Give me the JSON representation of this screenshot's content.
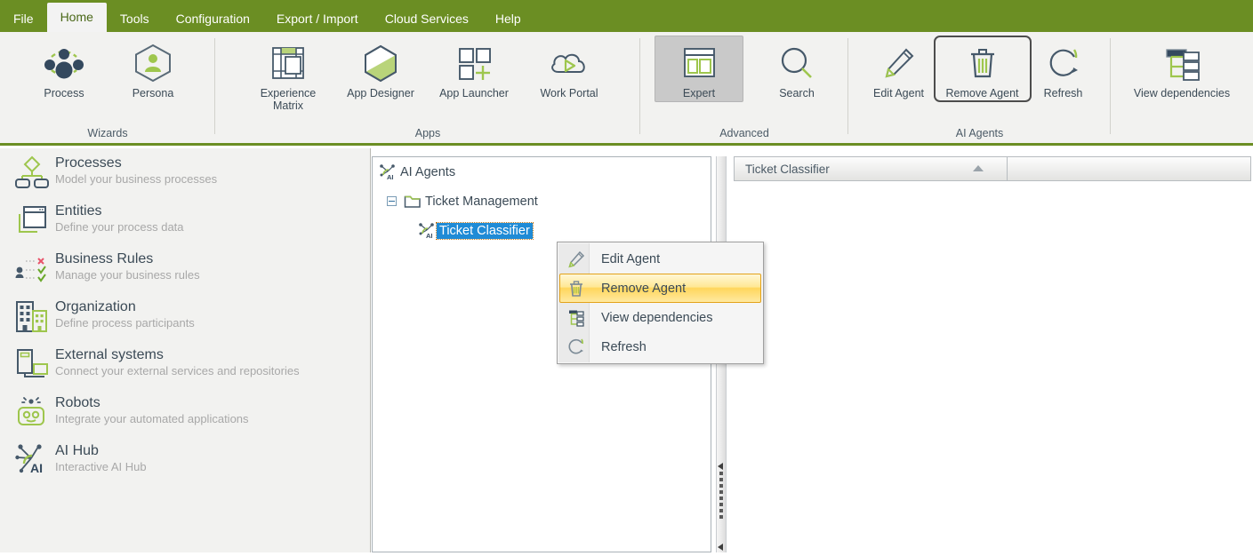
{
  "menubar": {
    "tabs": [
      {
        "label": "File",
        "active": false
      },
      {
        "label": "Home",
        "active": true
      },
      {
        "label": "Tools",
        "active": false
      },
      {
        "label": "Configuration",
        "active": false
      },
      {
        "label": "Export / Import",
        "active": false
      },
      {
        "label": "Cloud Services",
        "active": false
      },
      {
        "label": "Help",
        "active": false
      }
    ]
  },
  "ribbon": {
    "groups": [
      {
        "name": "Wizards",
        "label": "Wizards",
        "buttons": [
          {
            "label": "Process",
            "icon": "process-network-icon"
          },
          {
            "label": "Persona",
            "icon": "persona-hexagon-icon"
          }
        ]
      },
      {
        "name": "Apps",
        "label": "Apps",
        "buttons": [
          {
            "label": "Experience\nMatrix",
            "icon": "experience-matrix-icon"
          },
          {
            "label": "App Designer",
            "icon": "app-designer-hexagon-icon"
          },
          {
            "label": "App Launcher",
            "icon": "app-launcher-icon"
          },
          {
            "label": "Work Portal",
            "icon": "work-portal-cloud-icon"
          }
        ]
      },
      {
        "name": "Advanced",
        "label": "Advanced",
        "buttons": [
          {
            "label": "Expert",
            "icon": "expert-layout-icon",
            "state": "pressed"
          },
          {
            "label": "Search",
            "icon": "search-magnifier-icon"
          }
        ]
      },
      {
        "name": "AI Agents",
        "label": "AI Agents",
        "buttons": [
          {
            "label": "Edit Agent",
            "icon": "pencil-icon"
          },
          {
            "label": "Remove Agent",
            "icon": "trash-icon",
            "state": "highlighted"
          },
          {
            "label": "Refresh",
            "icon": "refresh-circular-arrow-icon"
          }
        ]
      },
      {
        "name": "View",
        "label": "",
        "buttons": [
          {
            "label": "View dependencies",
            "icon": "dependency-tree-icon"
          }
        ]
      }
    ]
  },
  "sidebar": {
    "items": [
      {
        "title": "Processes",
        "subtitle": "Model your business processes",
        "icon": "process-diagram-icon"
      },
      {
        "title": "Entities",
        "subtitle": "Define your process data",
        "icon": "entities-windows-icon"
      },
      {
        "title": "Business  Rules",
        "subtitle": "Manage your business rules",
        "icon": "business-rules-icon"
      },
      {
        "title": "Organization",
        "subtitle": "Define process participants",
        "icon": "organization-building-icon"
      },
      {
        "title": "External systems",
        "subtitle": "Connect your external services and repositories",
        "icon": "external-systems-icon"
      },
      {
        "title": "Robots",
        "subtitle": "Integrate your automated applications",
        "icon": "robot-icon"
      },
      {
        "title": "AI Hub",
        "subtitle": "Interactive AI Hub",
        "icon": "ai-hub-icon"
      }
    ]
  },
  "tree": {
    "nodes": [
      {
        "label": "AI Agents",
        "icon": "ai-agent-node-icon",
        "depth": 0,
        "expander": "none",
        "selected": false
      },
      {
        "label": "Ticket Management",
        "icon": "folder-icon",
        "depth": 1,
        "expander": "expanded",
        "selected": false
      },
      {
        "label": "Ticket Classifier",
        "icon": "ai-agent-node-icon",
        "depth": 2,
        "expander": "none",
        "selected": true
      }
    ]
  },
  "context_menu": {
    "items": [
      {
        "label": "Edit Agent",
        "icon": "pencil-icon",
        "highlighted": false
      },
      {
        "label": "Remove Agent",
        "icon": "trash-icon",
        "highlighted": true
      },
      {
        "label": "View dependencies",
        "icon": "dependency-tree-icon",
        "highlighted": false
      },
      {
        "label": "Refresh",
        "icon": "refresh-circular-arrow-icon",
        "highlighted": false
      }
    ]
  },
  "right_panel": {
    "columns": [
      {
        "label": "Ticket Classifier",
        "sort": "ascending"
      },
      {
        "label": "",
        "sort": "none"
      }
    ]
  },
  "colors": {
    "brand_green": "#6b8e23",
    "accent_green": "#9ec64d",
    "dark_navy": "#34495e",
    "selection_blue": "#1f8bd6",
    "menu_highlight": "#ffd65c",
    "ribbon_bg": "#f2f2f0"
  }
}
